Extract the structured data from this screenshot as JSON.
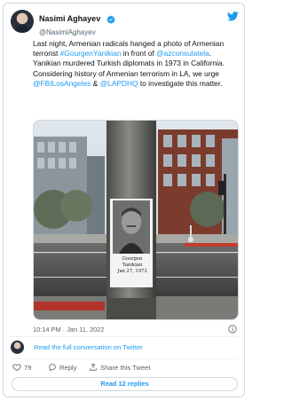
{
  "author": {
    "display_name": "Nasimi Aghayev",
    "handle": "@NasimiAghayev"
  },
  "tweet": {
    "segments": [
      {
        "text": "Last night, Armenian radicals hanged a photo of Armenian terrorist ",
        "link": false
      },
      {
        "text": "#GourgenYanikian",
        "link": true
      },
      {
        "text": " in front of ",
        "link": false
      },
      {
        "text": "@azconsulatela",
        "link": true
      },
      {
        "text": ". Yanikian murdered Turkish diplomats in 1973 in California. Considering history of Armenian terrorism in LA, we urge ",
        "link": false
      },
      {
        "text": "@FBILosAngeles",
        "link": true
      },
      {
        "text": " & ",
        "link": false
      },
      {
        "text": "@LAPDHQ",
        "link": true
      },
      {
        "text": " to investigate this matter.",
        "link": false
      }
    ]
  },
  "photo": {
    "caption_line1": "Gourgen Yanikian",
    "caption_line2": "Jan 27, 1973"
  },
  "meta": {
    "timestamp": "10:14 PM · Jan 11, 2022"
  },
  "conversation_link": "Read the full conversation on Twitter",
  "actions": {
    "likes": "79",
    "reply_label": "Reply",
    "share_label": "Share this Tweet"
  },
  "replies_button": "Read 12 replies",
  "colors": {
    "link": "#1d9bf0",
    "like_red": "#f91880",
    "muted": "#536471",
    "border": "#cfd9de"
  }
}
